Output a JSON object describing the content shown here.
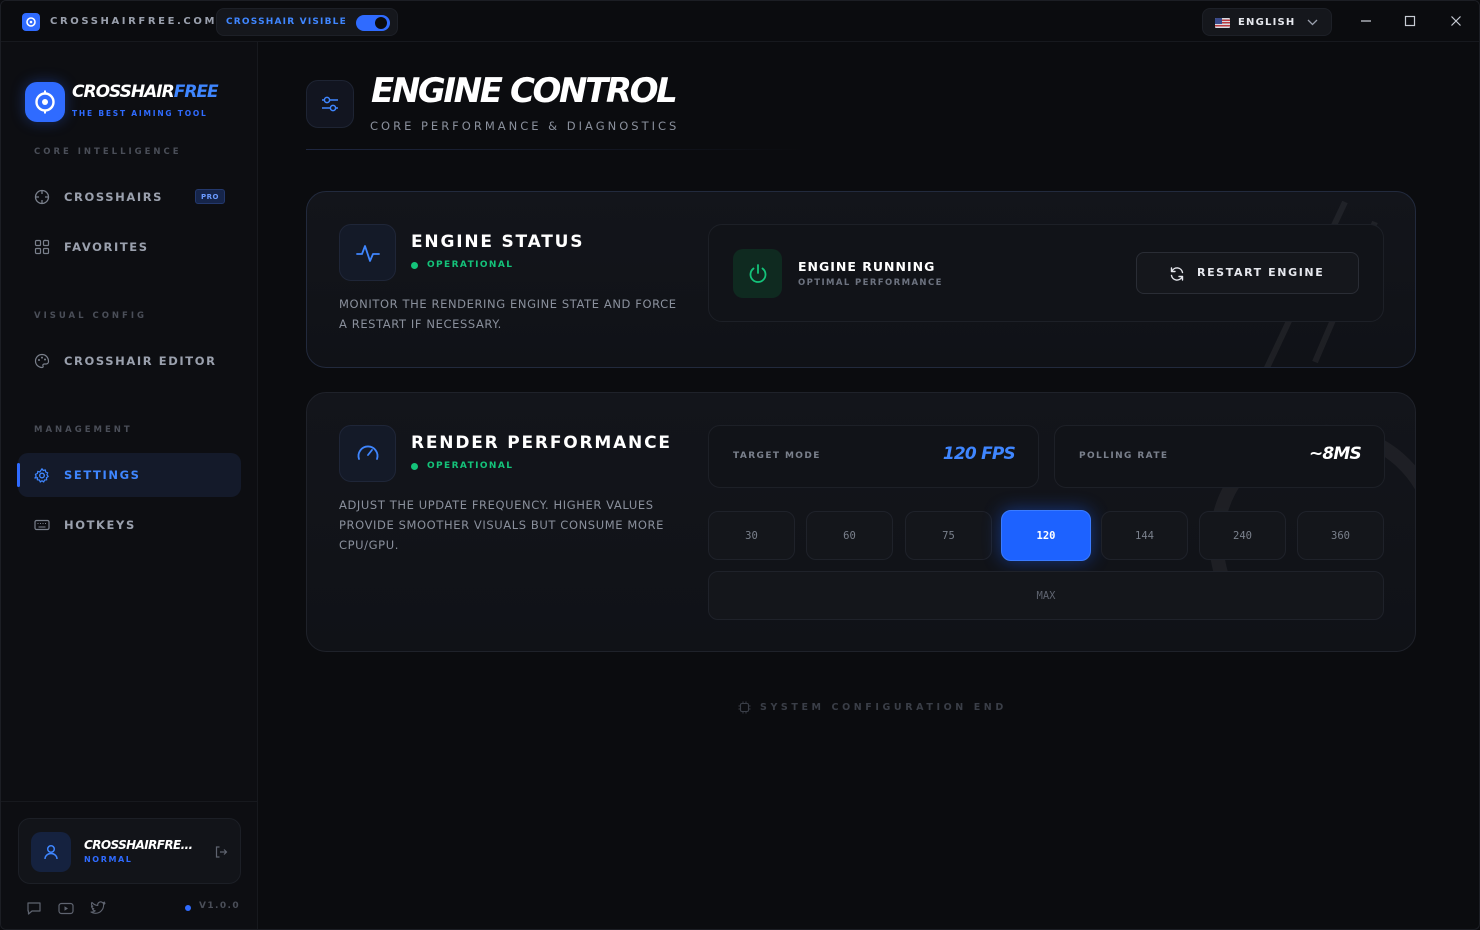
{
  "titlebar": {
    "site": "CROSSHAIRFREE.COM",
    "toggle_label": "CROSSHAIR VISIBLE",
    "toggle_on": true,
    "language": "ENGLISH"
  },
  "sidebar": {
    "brand_main": "CROSSHAIR",
    "brand_accent": "FREE",
    "brand_tagline": "THE BEST AIMING TOOL",
    "sections": [
      {
        "label": "CORE INTELLIGENCE"
      },
      {
        "label": "VISUAL CONFIG"
      },
      {
        "label": "MANAGEMENT"
      }
    ],
    "items": [
      {
        "label": "CROSSHAIRS",
        "badge": "PRO",
        "icon": "crosshair-icon"
      },
      {
        "label": "FAVORITES",
        "icon": "grid-icon"
      },
      {
        "label": "CROSSHAIR EDITOR",
        "icon": "palette-icon"
      },
      {
        "label": "SETTINGS",
        "icon": "gear-icon",
        "active": true
      },
      {
        "label": "HOTKEYS",
        "icon": "keyboard-icon"
      }
    ],
    "user": {
      "name": "CROSSHAIRFRE...",
      "role": "NORMAL"
    },
    "version": "V1.0.0"
  },
  "page": {
    "title": "ENGINE CONTROL",
    "subtitle": "CORE PERFORMANCE & DIAGNOSTICS"
  },
  "engine_status": {
    "title": "ENGINE STATUS",
    "status": "OPERATIONAL",
    "description": "MONITOR THE RENDERING ENGINE STATE AND FORCE A RESTART IF NECESSARY.",
    "state_title": "ENGINE RUNNING",
    "state_subtitle": "OPTIMAL PERFORMANCE",
    "restart_label": "RESTART ENGINE"
  },
  "render_performance": {
    "title": "RENDER PERFORMANCE",
    "status": "OPERATIONAL",
    "description": "ADJUST THE UPDATE FREQUENCY. HIGHER VALUES PROVIDE SMOOTHER VISUALS BUT CONSUME MORE CPU/GPU.",
    "target_mode_label": "TARGET MODE",
    "target_mode_value": "120 FPS",
    "polling_rate_label": "POLLING RATE",
    "polling_rate_value": "~8MS",
    "fps_options": [
      "30",
      "60",
      "75",
      "120",
      "144",
      "240",
      "360"
    ],
    "selected_fps": "120",
    "max_label": "MAX"
  },
  "footer": {
    "end_label": "SYSTEM CONFIGURATION END"
  },
  "colors": {
    "accent": "#2f6bff",
    "success": "#14c37a",
    "background": "#0b0c0f"
  }
}
